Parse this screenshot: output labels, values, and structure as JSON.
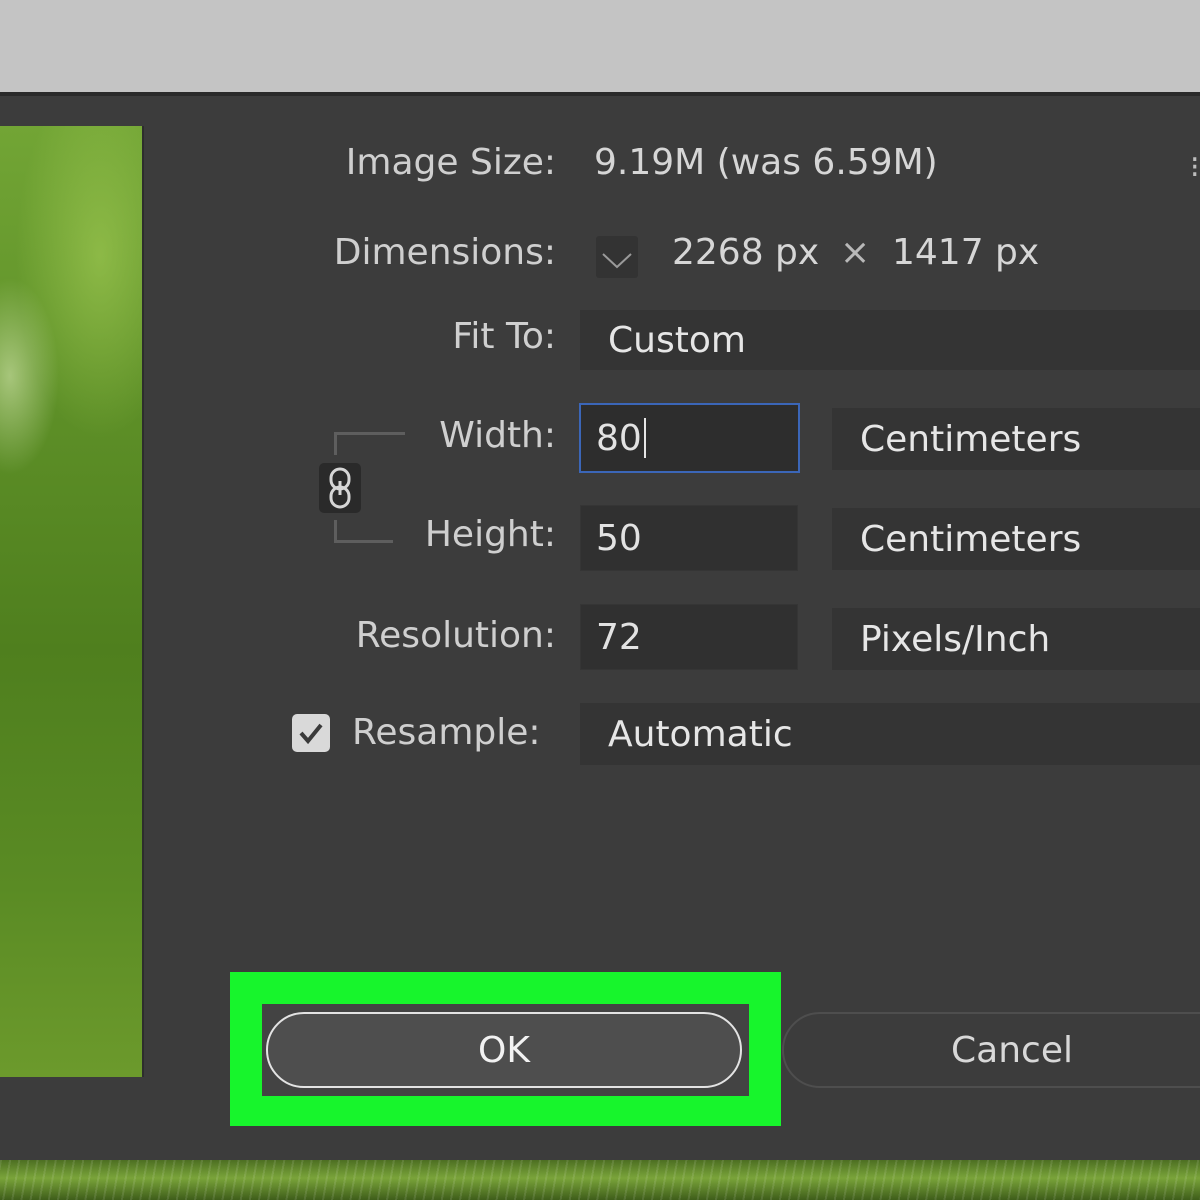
{
  "image_size": {
    "label": "Image Size:",
    "value": "9.19M (was 6.59M)"
  },
  "dimensions": {
    "label": "Dimensions:",
    "width": "2268 px",
    "separator": "×",
    "height": "1417 px"
  },
  "fit_to": {
    "label": "Fit To:",
    "value": "Custom"
  },
  "width": {
    "label": "Width:",
    "value": "80",
    "unit": "Centimeters"
  },
  "height": {
    "label": "Height:",
    "value": "50",
    "unit": "Centimeters"
  },
  "resolution": {
    "label": "Resolution:",
    "value": "72",
    "unit": "Pixels/Inch"
  },
  "resample": {
    "label": "Resample:",
    "value": "Automatic",
    "checked": true
  },
  "buttons": {
    "ok": "OK",
    "cancel": "Cancel"
  },
  "colors": {
    "highlight": "#17f52c",
    "active_border": "#3b66b8",
    "dialog_bg": "#3c3c3c"
  },
  "icons": [
    "chevron-down-icon",
    "chain-link-icon",
    "checkmark-icon"
  ]
}
